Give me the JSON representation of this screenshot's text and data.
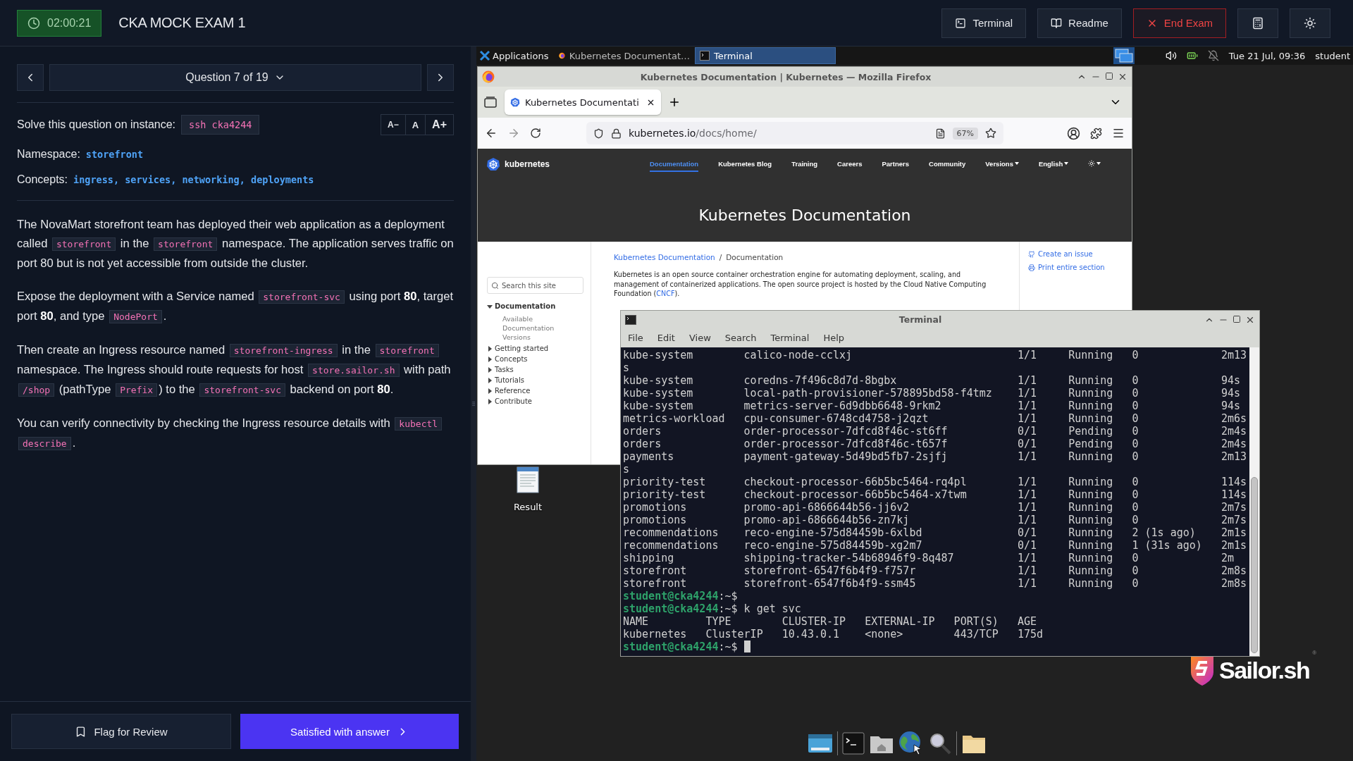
{
  "exam": {
    "timer": "02:00:21",
    "title": "CKA MOCK EXAM 1",
    "actions": [
      {
        "kind": "terminal",
        "label": "Terminal"
      },
      {
        "kind": "readme",
        "label": "Readme"
      },
      {
        "kind": "end",
        "label": "End Exam"
      },
      {
        "kind": "calculator"
      },
      {
        "kind": "theme"
      }
    ]
  },
  "question": {
    "selector": "Question 7 of 19",
    "instance_label": "Solve this question on instance:",
    "instance": "ssh cka4244",
    "font_sizes": [
      "A−",
      "A",
      "A+"
    ],
    "namespace_label": "Namespace:",
    "namespace": "storefront",
    "concepts_label": "Concepts:",
    "concepts": "ingress, services, networking, deployments",
    "paragraphs": [
      [
        {
          "kind": "text",
          "text": "The NovaMart storefront team has deployed their web application as a deployment called "
        },
        {
          "kind": "code",
          "text": "storefront"
        },
        {
          "kind": "text",
          "text": " in the "
        },
        {
          "kind": "code",
          "text": "storefront"
        },
        {
          "kind": "text",
          "text": " namespace. The application serves traffic on port 80 but is not yet accessible from outside the cluster."
        }
      ],
      [
        {
          "kind": "text",
          "text": "Expose the deployment with a Service named "
        },
        {
          "kind": "code",
          "text": "storefront-svc"
        },
        {
          "kind": "text",
          "text": " using port **80**, target port **80**, and type "
        },
        {
          "kind": "code",
          "text": "NodePort"
        },
        {
          "kind": "text",
          "text": "."
        }
      ],
      [
        {
          "kind": "text",
          "text": "Then create an Ingress resource named "
        },
        {
          "kind": "code",
          "text": "storefront-ingress"
        },
        {
          "kind": "text",
          "text": " in the "
        },
        {
          "kind": "code",
          "text": "storefront"
        },
        {
          "kind": "text",
          "text": " namespace. The Ingress should route requests for host "
        },
        {
          "kind": "code",
          "text": "store.sailor.sh"
        },
        {
          "kind": "text",
          "text": " with path "
        },
        {
          "kind": "code",
          "text": "/shop"
        },
        {
          "kind": "text",
          "text": " (pathType "
        },
        {
          "kind": "code",
          "text": "Prefix"
        },
        {
          "kind": "text",
          "text": ") to the "
        },
        {
          "kind": "code",
          "text": "storefront-svc"
        },
        {
          "kind": "text",
          "text": " backend on port **80**."
        }
      ],
      [
        {
          "kind": "text",
          "text": "You can verify connectivity by checking the Ingress resource details with "
        },
        {
          "kind": "code",
          "text": "kubectl describe"
        },
        {
          "kind": "text",
          "text": "."
        }
      ]
    ]
  },
  "footer": {
    "flag": "Flag for Review",
    "submit": "Satisfied with answer"
  },
  "desktop_panel": {
    "menu": "Applications",
    "tasks": [
      {
        "kind": "firefox",
        "title": "Kubernetes Documentat…",
        "selected": false
      },
      {
        "kind": "terminal",
        "title": "Terminal",
        "selected": true
      }
    ],
    "clock": "Tue 21 Jul, 09:36",
    "user": "student"
  },
  "firefox": {
    "window_title": "Kubernetes Documentation | Kubernetes — Mozilla Firefox",
    "tab": "Kubernetes Documentati",
    "url_host": "kubernetes.io",
    "url_path": "/docs/home/",
    "zoom": "67%",
    "site": {
      "brand": "kubernetes",
      "nav": [
        {
          "kind": "link",
          "label": "Documentation",
          "selected": true
        },
        {
          "kind": "link",
          "label": "Kubernetes Blog",
          "selected": false
        },
        {
          "kind": "link",
          "label": "Training",
          "selected": false
        },
        {
          "kind": "link",
          "label": "Careers",
          "selected": false
        },
        {
          "kind": "link",
          "label": "Partners",
          "selected": false
        },
        {
          "kind": "link",
          "label": "Community",
          "selected": false
        },
        {
          "kind": "dropdown",
          "label": "Versions",
          "selected": false
        },
        {
          "kind": "dropdown",
          "label": "English",
          "selected": false
        },
        {
          "kind": "theme",
          "selected": false
        }
      ],
      "hero": "Kubernetes Documentation",
      "search_placeholder": "Search this site",
      "tree": [
        {
          "label": "Documentation",
          "expanded": true,
          "children": [
            {
              "label": "Available Documentation Versions"
            }
          ]
        },
        {
          "label": "Getting started",
          "expanded": false
        },
        {
          "label": "Concepts",
          "expanded": false
        },
        {
          "label": "Tasks",
          "expanded": false
        },
        {
          "label": "Tutorials",
          "expanded": false
        },
        {
          "label": "Reference",
          "expanded": false
        },
        {
          "label": "Contribute",
          "expanded": false
        }
      ],
      "breadcrumb": {
        "items": [
          "Kubernetes Documentation",
          "Documentation"
        ],
        "separator": "/"
      },
      "intro": {
        "before": "Kubernetes is an open source container orchestration engine for automating deployment, scaling, and management of containerized applications. The open source project is hosted by the Cloud Native Computing Foundation (",
        "link": "CNCF",
        "after": ")."
      },
      "side_links": [
        {
          "kind": "github",
          "label": "Create an issue"
        },
        {
          "kind": "print",
          "label": "Print entire section"
        }
      ]
    }
  },
  "terminal": {
    "title": "Terminal",
    "menu": [
      "File",
      "Edit",
      "View",
      "Search",
      "Terminal",
      "Help"
    ],
    "lines": [
      {
        "kind": "pods",
        "cells": [
          "kube-system",
          "calico-node-cclxj",
          "1/1",
          "Running",
          "0",
          "2m13"
        ]
      },
      {
        "kind": "text",
        "text": "s"
      },
      {
        "kind": "pods",
        "cells": [
          "kube-system",
          "coredns-7f496c8d7d-8bgbx",
          "1/1",
          "Running",
          "0",
          "94s"
        ]
      },
      {
        "kind": "pods",
        "cells": [
          "kube-system",
          "local-path-provisioner-578895bd58-f4tmz",
          "1/1",
          "Running",
          "0",
          "94s"
        ]
      },
      {
        "kind": "pods",
        "cells": [
          "kube-system",
          "metrics-server-6d9dbb6648-9rkm2",
          "1/1",
          "Running",
          "0",
          "94s"
        ]
      },
      {
        "kind": "pods",
        "cells": [
          "metrics-workload",
          "cpu-consumer-6748cd4758-j2qzt",
          "1/1",
          "Running",
          "0",
          "2m6s"
        ]
      },
      {
        "kind": "pods",
        "cells": [
          "orders",
          "order-processor-7dfcd8f46c-st6ff",
          "0/1",
          "Pending",
          "0",
          "2m4s"
        ]
      },
      {
        "kind": "pods",
        "cells": [
          "orders",
          "order-processor-7dfcd8f46c-t657f",
          "0/1",
          "Pending",
          "0",
          "2m4s"
        ]
      },
      {
        "kind": "pods",
        "cells": [
          "payments",
          "payment-gateway-5d49bd5fb7-2sjfj",
          "1/1",
          "Running",
          "0",
          "2m13"
        ]
      },
      {
        "kind": "text",
        "text": "s"
      },
      {
        "kind": "pods",
        "cells": [
          "priority-test",
          "checkout-processor-66b5bc5464-rq4pl",
          "1/1",
          "Running",
          "0",
          "114s"
        ]
      },
      {
        "kind": "pods",
        "cells": [
          "priority-test",
          "checkout-processor-66b5bc5464-x7twm",
          "1/1",
          "Running",
          "0",
          "114s"
        ]
      },
      {
        "kind": "pods",
        "cells": [
          "promotions",
          "promo-api-6866644b56-jj6v2",
          "1/1",
          "Running",
          "0",
          "2m7s"
        ]
      },
      {
        "kind": "pods",
        "cells": [
          "promotions",
          "promo-api-6866644b56-zn7kj",
          "1/1",
          "Running",
          "0",
          "2m7s"
        ]
      },
      {
        "kind": "pods",
        "cells": [
          "recommendations",
          "reco-engine-575d84459b-6xlbd",
          "0/1",
          "Running",
          "2 (1s ago)",
          "2m1s"
        ]
      },
      {
        "kind": "pods",
        "cells": [
          "recommendations",
          "reco-engine-575d84459b-xg2m7",
          "0/1",
          "Running",
          "1 (31s ago)",
          "2m1s"
        ]
      },
      {
        "kind": "pods",
        "cells": [
          "shipping",
          "shipping-tracker-54b68946f9-8q487",
          "1/1",
          "Running",
          "0",
          "2m"
        ]
      },
      {
        "kind": "pods",
        "cells": [
          "storefront",
          "storefront-6547f6b4f9-f757r",
          "1/1",
          "Running",
          "0",
          "2m8s"
        ]
      },
      {
        "kind": "pods",
        "cells": [
          "storefront",
          "storefront-6547f6b4f9-ssm45",
          "1/1",
          "Running",
          "0",
          "2m8s"
        ]
      },
      {
        "kind": "prompt",
        "user": "student@cka4244",
        "rest": ":~$",
        "cursor": false
      },
      {
        "kind": "prompt",
        "user": "student@cka4244",
        "rest": ":~$ k get svc",
        "cursor": false
      },
      {
        "kind": "svc",
        "cells": [
          "NAME",
          "TYPE",
          "CLUSTER-IP",
          "EXTERNAL-IP",
          "PORT(S)",
          "AGE"
        ]
      },
      {
        "kind": "svc",
        "cells": [
          "kubernetes",
          "ClusterIP",
          "10.43.0.1",
          "<none>",
          "443/TCP",
          "175d"
        ]
      },
      {
        "kind": "prompt",
        "user": "student@cka4244",
        "rest": ":~$ ",
        "cursor": true
      }
    ]
  },
  "desktop_icons": [
    {
      "label": "Result"
    }
  ],
  "logo": {
    "name": "Sailor.sh",
    "mark": "®"
  },
  "dock": [
    {
      "kind": "desktop"
    },
    {
      "kind": "separator"
    },
    {
      "kind": "terminal"
    },
    {
      "kind": "home"
    },
    {
      "kind": "browser"
    },
    {
      "kind": "search"
    },
    {
      "kind": "separator"
    },
    {
      "kind": "files"
    }
  ]
}
